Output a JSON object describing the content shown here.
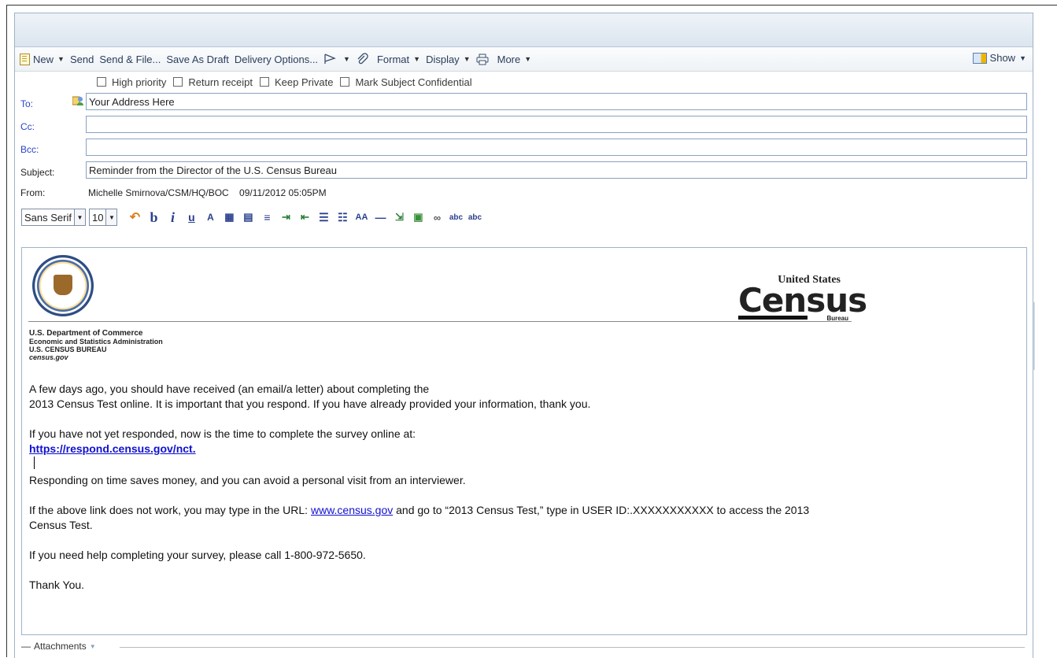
{
  "toolbar": {
    "new": "New",
    "send": "Send",
    "send_file": "Send & File...",
    "save_draft": "Save As Draft",
    "delivery": "Delivery Options...",
    "format": "Format",
    "display": "Display",
    "more": "More",
    "show": "Show"
  },
  "options": {
    "high_priority": "High priority",
    "return_receipt": "Return receipt",
    "keep_private": "Keep Private",
    "mark_confidential": "Mark Subject Confidential"
  },
  "header": {
    "to_label": "To:",
    "to_value": "Your Address Here",
    "cc_label": "Cc:",
    "cc_value": "",
    "bcc_label": "Bcc:",
    "bcc_value": "",
    "subject_label": "Subject:",
    "subject_value": "Reminder from the Director of the U.S. Census Bureau",
    "from_label": "From:",
    "from_value": "Michelle Smirnova/CSM/HQ/BOC    09/11/2012 05:05PM"
  },
  "format": {
    "font": "Sans Serif",
    "size": "10"
  },
  "letterhead": {
    "logo_top": "United States",
    "logo_main": "Census",
    "logo_bottom": "Bureau",
    "dept_line1": "U.S. Department of Commerce",
    "dept_line2": "Economic and Statistics Administration",
    "dept_line3": "U.S. CENSUS BUREAU",
    "dept_line4": "census.gov"
  },
  "body": {
    "p1_line1": "A few days ago, you should have received (an email/a letter) about completing the",
    "p1_line2": "2013 Census Test online. It is important that you respond. If you have already provided your information, thank you.",
    "p2": "If you have not yet responded, now is the time to complete the survey online at:",
    "p2_link": "https://respond.census.gov/nct.",
    "p3": "Responding on time saves money, and you can avoid a personal visit from an interviewer.",
    "p4_pre": "If the above link does not work, you may type in the URL: ",
    "p4_link": "www.census.gov",
    "p4_post": " and go to “2013 Census Test,” type in USER ID:.XXXXXXXXXXX to access the 2013",
    "p4_line2": "Census Test.",
    "p5": "If you need help completing your survey, please call 1-800-972-5650.",
    "p6": "Thank You."
  },
  "attachments": {
    "label": "Attachments"
  }
}
